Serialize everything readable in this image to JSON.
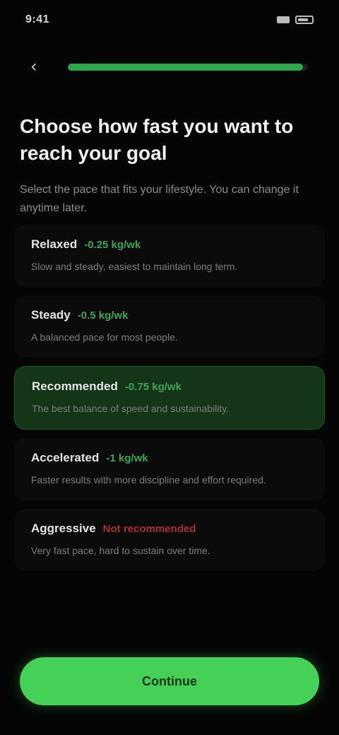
{
  "status_bar": {
    "time": "9:41"
  },
  "progress": {
    "fraction": 0.98
  },
  "header": {
    "title": "Choose how fast you want to reach your goal",
    "subtitle": "Select the pace that fits your lifestyle. You can change it anytime later."
  },
  "options": [
    {
      "name": "Relaxed",
      "tag": "-0.25 kg/wk",
      "desc": "Slow and steady, easiest to maintain long term."
    },
    {
      "name": "Steady",
      "tag": "-0.5 kg/wk",
      "desc": "A balanced pace for most people."
    },
    {
      "name": "Recommended",
      "tag": "-0.75 kg/wk",
      "desc": "The best balance of speed and sustainability."
    },
    {
      "name": "Accelerated",
      "tag": "-1 kg/wk",
      "desc": "Faster results with more discipline and effort required."
    },
    {
      "name": "Aggressive",
      "tag": "Not recommended",
      "desc": "Very fast pace, hard to sustain over time."
    }
  ],
  "footer": {
    "continue_label": "Continue"
  },
  "colors": {
    "accent": "#45d058",
    "selected_bg": "#143518",
    "warning": "#a83232"
  }
}
